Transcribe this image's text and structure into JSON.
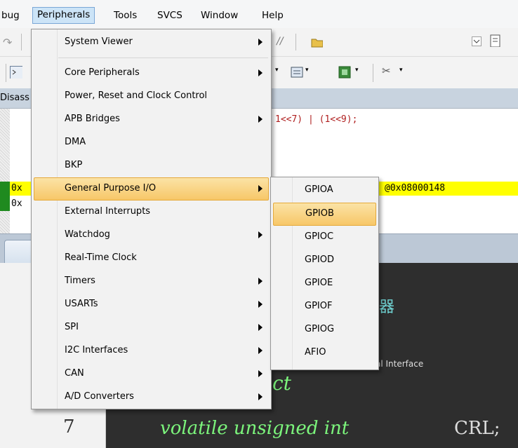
{
  "menubar": {
    "items": [
      "bug",
      "Peripherals",
      "Tools",
      "SVCS",
      "Window",
      "Help"
    ]
  },
  "disassembly": {
    "tab_label": "Disass",
    "code_line": "1<<7) | (1<<9);",
    "addr1": "0x",
    "addr2": "0x",
    "highlight_text": "@0x08000148"
  },
  "editor": {
    "line_number": "7",
    "code_keyword": "volatile unsigned int",
    "code_field": "CRL;",
    "code_partial": "ct",
    "hidden_text": "al Interface"
  },
  "peripherals_menu": {
    "items": [
      {
        "label": "System Viewer",
        "submenu": true
      },
      {
        "label": "Core Peripherals",
        "submenu": true
      },
      {
        "label": "Power, Reset and Clock Control",
        "submenu": false
      },
      {
        "label": "APB Bridges",
        "submenu": true
      },
      {
        "label": "DMA",
        "submenu": false
      },
      {
        "label": "BKP",
        "submenu": false
      },
      {
        "label": "General Purpose I/O",
        "submenu": true
      },
      {
        "label": "External Interrupts",
        "submenu": false
      },
      {
        "label": "Watchdog",
        "submenu": true
      },
      {
        "label": "Real-Time Clock",
        "submenu": false
      },
      {
        "label": "Timers",
        "submenu": true
      },
      {
        "label": "USARTs",
        "submenu": true
      },
      {
        "label": "SPI",
        "submenu": true
      },
      {
        "label": "I2C Interfaces",
        "submenu": true
      },
      {
        "label": "CAN",
        "submenu": true
      },
      {
        "label": "A/D Converters",
        "submenu": true
      }
    ]
  },
  "gpio_submenu": {
    "items": [
      "GPIOA",
      "GPIOB",
      "GPIOC",
      "GPIOD",
      "GPIOE",
      "GPIOF",
      "GPIOG",
      "AFIO"
    ]
  },
  "colors": {
    "menu_highlight": "#f7c768",
    "line_highlight": "#ffff00",
    "editor_bg": "#2e2e2e",
    "keyword": "#7cf57c"
  }
}
